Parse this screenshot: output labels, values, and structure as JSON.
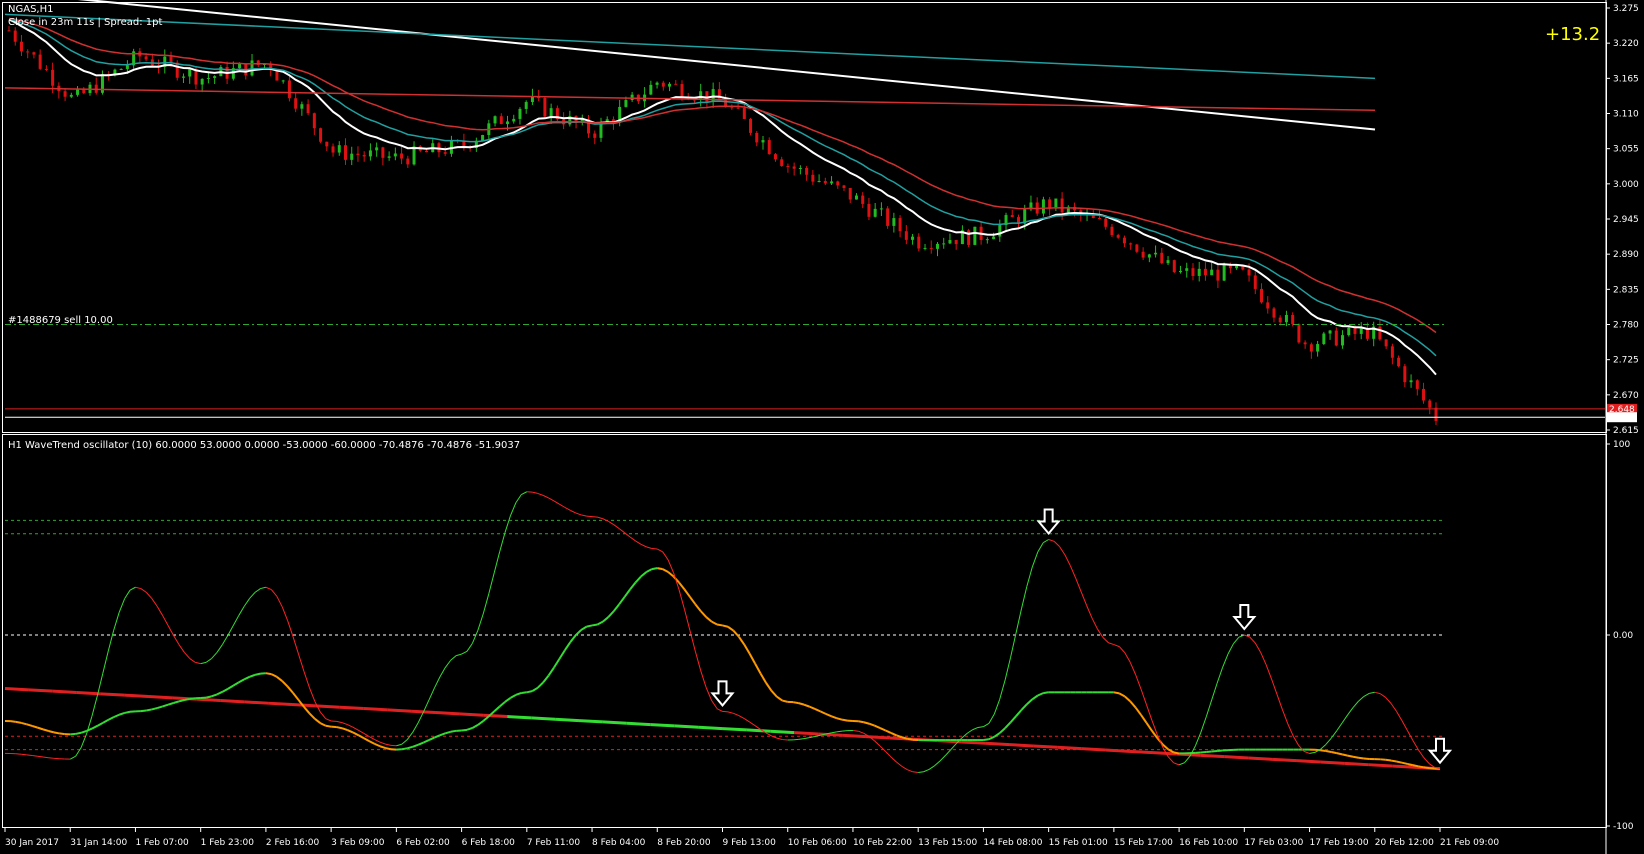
{
  "window": {
    "symbol_title": "NGAS,H1",
    "info": "Close in 23m 11s | Spread: 1pt",
    "profit_label": "+13.2"
  },
  "order": {
    "label": "#1488679 sell 10.00",
    "price": 2.78
  },
  "colors": {
    "background": "#000000",
    "bull_candle": "#22bb22",
    "bear_candle": "#dd1111",
    "ma_white": "#ffffff",
    "ma_teal": "#20a0a0",
    "ma_red": "#d03030",
    "profit": "#ffff00",
    "level_green": "#2fa82f",
    "level_red": "#e02020",
    "osc_rise": "#33dd33",
    "osc_fall": "#ff2222",
    "osc_signal": "#ff9900"
  },
  "price_axis": {
    "ticks": [
      "3.275",
      "3.220",
      "3.165",
      "3.110",
      "3.055",
      "3.000",
      "2.945",
      "2.890",
      "2.835",
      "2.780",
      "2.725",
      "2.670",
      "2.615"
    ],
    "current_price": "2.635",
    "bid_marker": "2.648"
  },
  "indicator": {
    "title": "H1 WaveTrend oscillator (10) 60.0000 53.0000 0.0000 -53.0000 -60.0000 -70.4876 -70.4876 -51.9037",
    "axis_ticks": [
      "100",
      "0.00",
      "-100"
    ],
    "levels": [
      60,
      53,
      0,
      -53,
      -60
    ],
    "signal_icon": "down-arrow-icon"
  },
  "time_axis": {
    "labels": [
      "30 Jan 2017",
      "31 Jan 14:00",
      "1 Feb 07:00",
      "1 Feb 23:00",
      "2 Feb 16:00",
      "3 Feb 09:00",
      "6 Feb 02:00",
      "6 Feb 18:00",
      "7 Feb 11:00",
      "8 Feb 04:00",
      "8 Feb 20:00",
      "9 Feb 13:00",
      "10 Feb 06:00",
      "10 Feb 22:00",
      "13 Feb 15:00",
      "14 Feb 08:00",
      "15 Feb 01:00",
      "15 Feb 17:00",
      "16 Feb 10:00",
      "17 Feb 03:00",
      "17 Feb 19:00",
      "20 Feb 12:00",
      "21 Feb 09:00"
    ]
  },
  "chart_data": {
    "type": "line",
    "title": "NGAS,H1",
    "ylim": [
      2.615,
      3.275
    ],
    "price_path": [
      [
        "30 Jan 2017",
        3.24
      ],
      [
        "31 Jan 14:00",
        3.13
      ],
      [
        "1 Feb 07:00",
        3.2
      ],
      [
        "1 Feb 23:00",
        3.165
      ],
      [
        "2 Feb 16:00",
        3.19
      ],
      [
        "3 Feb 09:00",
        3.05
      ],
      [
        "6 Feb 02:00",
        3.04
      ],
      [
        "6 Feb 18:00",
        3.06
      ],
      [
        "7 Feb 11:00",
        3.13
      ],
      [
        "8 Feb 04:00",
        3.08
      ],
      [
        "8 Feb 20:00",
        3.16
      ],
      [
        "9 Feb 13:00",
        3.13
      ],
      [
        "10 Feb 06:00",
        3.03
      ],
      [
        "10 Feb 22:00",
        2.98
      ],
      [
        "13 Feb 15:00",
        2.91
      ],
      [
        "14 Feb 08:00",
        2.92
      ],
      [
        "15 Feb 01:00",
        2.97
      ],
      [
        "15 Feb 17:00",
        2.93
      ],
      [
        "16 Feb 10:00",
        2.86
      ],
      [
        "17 Feb 03:00",
        2.86
      ],
      [
        "17 Feb 19:00",
        2.75
      ],
      [
        "20 Feb 12:00",
        2.77
      ],
      [
        "21 Feb 09:00",
        2.635
      ]
    ],
    "oscillator": {
      "ylim": [
        -100,
        100
      ],
      "wavetrend": [
        -62,
        -65,
        25,
        -15,
        25,
        -45,
        -58,
        -10,
        75,
        62,
        45,
        -40,
        -55,
        -50,
        -72,
        -48,
        50,
        -5,
        -68,
        0,
        -62,
        -30,
        -70
      ],
      "signal": [
        -45,
        -52,
        -40,
        -33,
        -20,
        -48,
        -60,
        -50,
        -30,
        5,
        35,
        5,
        -35,
        -45,
        -55,
        -55,
        -30,
        -30,
        -62,
        -60,
        -60,
        -65,
        -70
      ],
      "signal_arrows_at": [
        "9 Feb 13:00",
        "15 Feb 01:00",
        "17 Feb 03:00",
        "21 Feb 09:00"
      ]
    }
  }
}
